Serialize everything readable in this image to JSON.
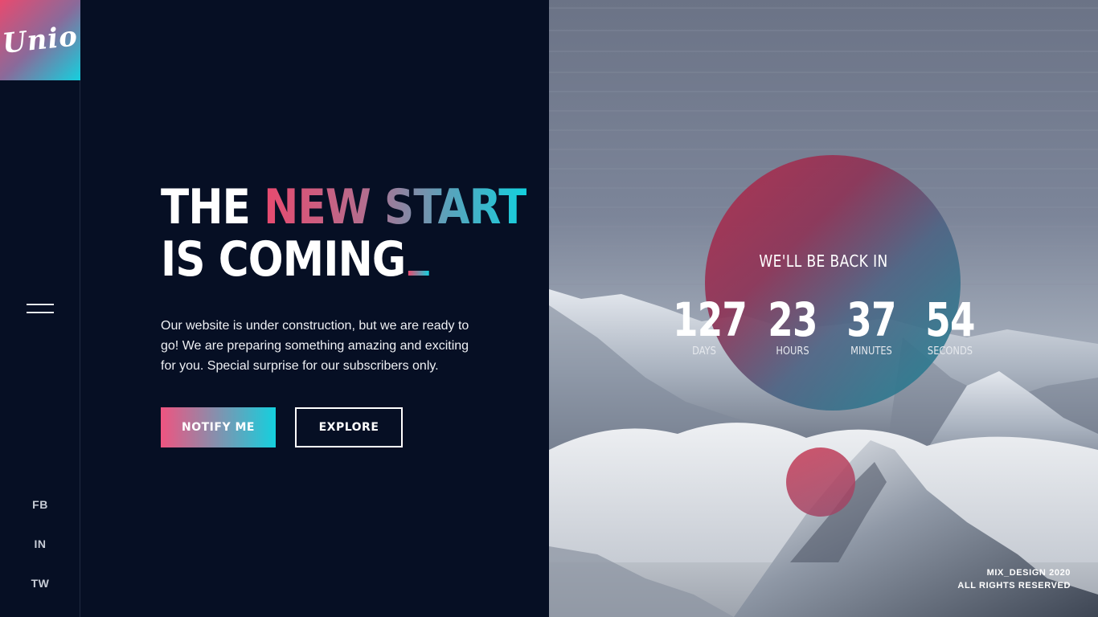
{
  "brand": {
    "logo_text": "Unio"
  },
  "sidebar": {
    "social": [
      {
        "label": "FB"
      },
      {
        "label": "IN"
      },
      {
        "label": "TW"
      }
    ]
  },
  "hero": {
    "headline_line1_word1": "THE",
    "headline_line1_word2": "NEW START",
    "headline_line2": "IS COMING",
    "description": "Our website is under construction, but we are ready to go! We are preparing something amazing and exciting for you. Special surprise for our subscribers only.",
    "notify_label": "NOTIFY ME",
    "explore_label": "EXPLORE"
  },
  "countdown": {
    "title": "WE'LL BE BACK IN",
    "days": {
      "value": "127",
      "label": "DAYS"
    },
    "hours": {
      "value": "23",
      "label": "HOURS"
    },
    "minutes": {
      "value": "37",
      "label": "MINUTES"
    },
    "seconds": {
      "value": "54",
      "label": "SECONDS"
    }
  },
  "footer": {
    "line1": "MIX_DESIGN 2020",
    "line2": "ALL RIGHTS RESERVED"
  },
  "colors": {
    "background": "#060f24",
    "accent_pink": "#e84a6f",
    "accent_cyan": "#14d0de"
  }
}
